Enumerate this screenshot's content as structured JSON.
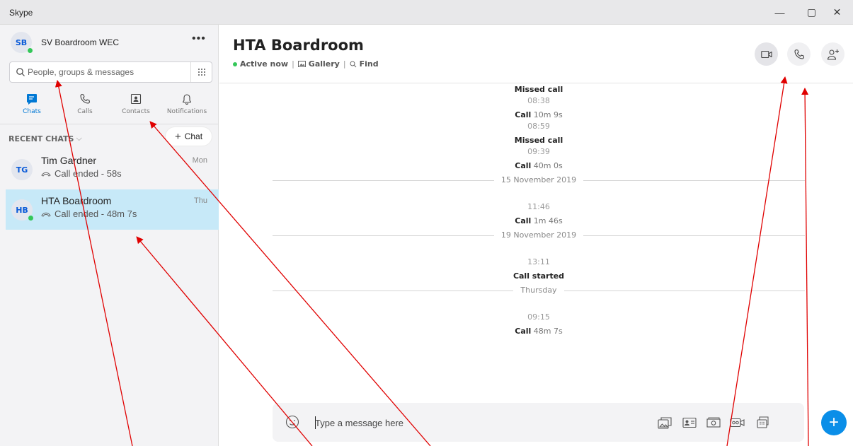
{
  "window": {
    "title": "Skype",
    "controls": {
      "minimize": "—",
      "maximize": "▢",
      "close": "✕"
    }
  },
  "profile": {
    "initials": "SB",
    "name": "SV Boardroom WEC",
    "more": "•••"
  },
  "search": {
    "placeholder": "People, groups & messages"
  },
  "nav": [
    {
      "label": "Chats",
      "icon": "chat-icon",
      "active": true
    },
    {
      "label": "Calls",
      "icon": "phone-icon",
      "active": false
    },
    {
      "label": "Contacts",
      "icon": "contacts-icon",
      "active": false
    },
    {
      "label": "Notifications",
      "icon": "bell-icon",
      "active": false
    }
  ],
  "recent": {
    "label": "RECENT CHATS",
    "chevron": "⌵",
    "new_chat_label": "Chat",
    "new_chat_plus": "+"
  },
  "chats": [
    {
      "initials": "TG",
      "name": "Tim Gardner",
      "preview": "Call ended - 58s",
      "date": "Mon",
      "online": false,
      "selected": false
    },
    {
      "initials": "HB",
      "name": "HTA Boardroom",
      "preview": "Call ended - 48m 7s",
      "date": "Thu",
      "online": true,
      "selected": true
    }
  ],
  "conversation": {
    "title": "HTA Boardroom",
    "status": "Active now",
    "gallery": "Gallery",
    "find": "Find",
    "separator": "|"
  },
  "events": [
    {
      "kind": "text",
      "bold": "Missed call",
      "rest": ""
    },
    {
      "kind": "time",
      "text": "08:38"
    },
    {
      "kind": "text",
      "bold": "Call",
      "rest": " 10m 9s"
    },
    {
      "kind": "time",
      "text": "08:59"
    },
    {
      "kind": "text",
      "bold": "Missed call",
      "rest": ""
    },
    {
      "kind": "time",
      "text": "09:39"
    },
    {
      "kind": "text",
      "bold": "Call",
      "rest": " 40m 0s"
    },
    {
      "kind": "day",
      "text": "15 November 2019"
    },
    {
      "kind": "time",
      "text": "11:46"
    },
    {
      "kind": "text",
      "bold": "Call",
      "rest": " 1m 46s"
    },
    {
      "kind": "day",
      "text": "19 November 2019"
    },
    {
      "kind": "time",
      "text": "13:11"
    },
    {
      "kind": "text",
      "bold": "Call started",
      "rest": ""
    },
    {
      "kind": "day",
      "text": "Thursday"
    },
    {
      "kind": "time",
      "text": "09:15"
    },
    {
      "kind": "text",
      "bold": "Call",
      "rest": " 48m 7s"
    }
  ],
  "composer": {
    "placeholder": "Type a message here"
  },
  "fab": {
    "symbol": "+"
  },
  "colors": {
    "accent": "#0078d4",
    "selected_row": "#c7e9f8",
    "presence": "#34c759",
    "annotation": "#e00000",
    "fab": "#0a8ee8"
  }
}
